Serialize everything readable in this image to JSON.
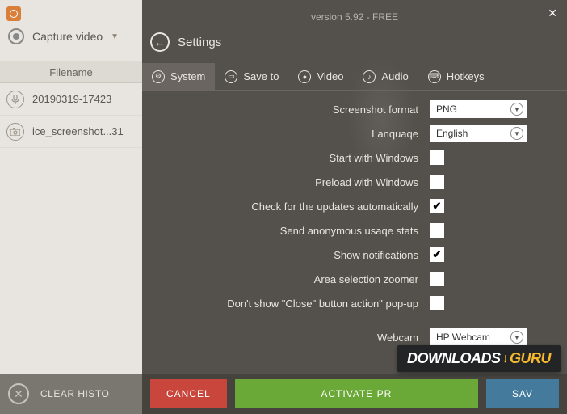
{
  "app": {
    "version_line": "version 5.92 - FREE"
  },
  "left": {
    "capture_label": "Capture video",
    "filename_header": "Filename",
    "files": [
      {
        "name": "20190319-17423"
      },
      {
        "name": "ice_screenshot...31"
      }
    ],
    "clear_history": "CLEAR HISTO"
  },
  "settings": {
    "title": "Settings",
    "tabs": {
      "system": "System",
      "save_to": "Save to",
      "video": "Video",
      "audio": "Audio",
      "hotkeys": "Hotkeys"
    },
    "rows": {
      "screenshot_format": {
        "label": "Screenshot format",
        "value": "PNG"
      },
      "language": {
        "label": "Lanquaqe",
        "value": "English"
      },
      "start_windows": {
        "label": "Start with Windows",
        "checked": false
      },
      "preload_windows": {
        "label": "Preload with Windows",
        "checked": false
      },
      "check_updates": {
        "label": "Check for the updates automatically",
        "checked": true
      },
      "usage_stats": {
        "label": "Send anonymous usaqe stats",
        "checked": false
      },
      "notifications": {
        "label": "Show notifications",
        "checked": true
      },
      "area_zoomer": {
        "label": "Area selection zoomer",
        "checked": false
      },
      "close_popup": {
        "label": "Don't show \"Close\" button action\" pop-up",
        "checked": false
      },
      "webcam": {
        "label": "Webcam",
        "value": "HP Webcam"
      }
    },
    "buttons": {
      "cancel": "CANCEL",
      "activate": "ACTIVATE PR",
      "save": "SAV"
    }
  },
  "watermark": {
    "downloads": "DOWNLOADS",
    "guru": "GURU"
  }
}
